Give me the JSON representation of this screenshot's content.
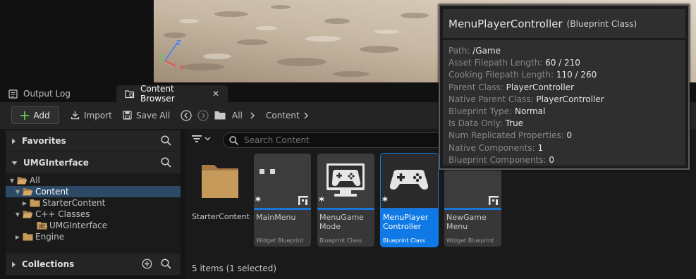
{
  "tabs": [
    {
      "label": "Output Log"
    },
    {
      "label": "Content Browser"
    }
  ],
  "toolbar": {
    "add": "Add",
    "import": "Import",
    "save_all": "Save All",
    "breadcrumb": [
      "All",
      "Content"
    ]
  },
  "sidebar": {
    "favorites": "Favorites",
    "project": "UMGInterface",
    "collections": "Collections",
    "tree": [
      {
        "label": "All"
      },
      {
        "label": "Content"
      },
      {
        "label": "StarterContent"
      },
      {
        "label": "C++ Classes"
      },
      {
        "label": "UMGInterface"
      },
      {
        "label": "Engine"
      }
    ]
  },
  "content": {
    "search_placeholder": "Search Content",
    "folder": {
      "name": "StarterContent"
    },
    "assets": [
      {
        "name": "MainMenu",
        "type": "Widget Blueprint",
        "selected": false
      },
      {
        "name": "MenuGame Mode",
        "type": "Blueprint Class",
        "selected": false
      },
      {
        "name": "MenuPlayer Controller",
        "type": "Blueprint Class",
        "selected": true
      },
      {
        "name": "NewGame Menu",
        "type": "Widget Blueprint",
        "selected": false
      }
    ],
    "status": "5 items (1 selected)"
  },
  "tooltip": {
    "title": "MenuPlayerController",
    "subtitle": "(Blueprint Class)",
    "properties": [
      {
        "key": "Path:",
        "value": "/Game"
      },
      {
        "key": "Asset Filepath Length:",
        "value": "60 / 210"
      },
      {
        "key": "Cooking Filepath Length:",
        "value": "110 / 260"
      },
      {
        "key": "Parent Class:",
        "value": "PlayerController"
      },
      {
        "key": "Native Parent Class:",
        "value": "PlayerController"
      },
      {
        "key": "Blueprint Type:",
        "value": "Normal"
      },
      {
        "key": "Is Data Only:",
        "value": "True"
      },
      {
        "key": "Num Replicated Properties:",
        "value": "0"
      },
      {
        "key": "Native Components:",
        "value": "1"
      },
      {
        "key": "Blueprint Components:",
        "value": "0"
      }
    ]
  },
  "colors": {
    "accent": "#0f7ae5",
    "selection_row": "#2c4a66",
    "folder": "#c69a5a",
    "add_plus": "#5fbf48"
  },
  "viewport_axes": {
    "x": "X",
    "y": "Y",
    "z": "Z"
  }
}
